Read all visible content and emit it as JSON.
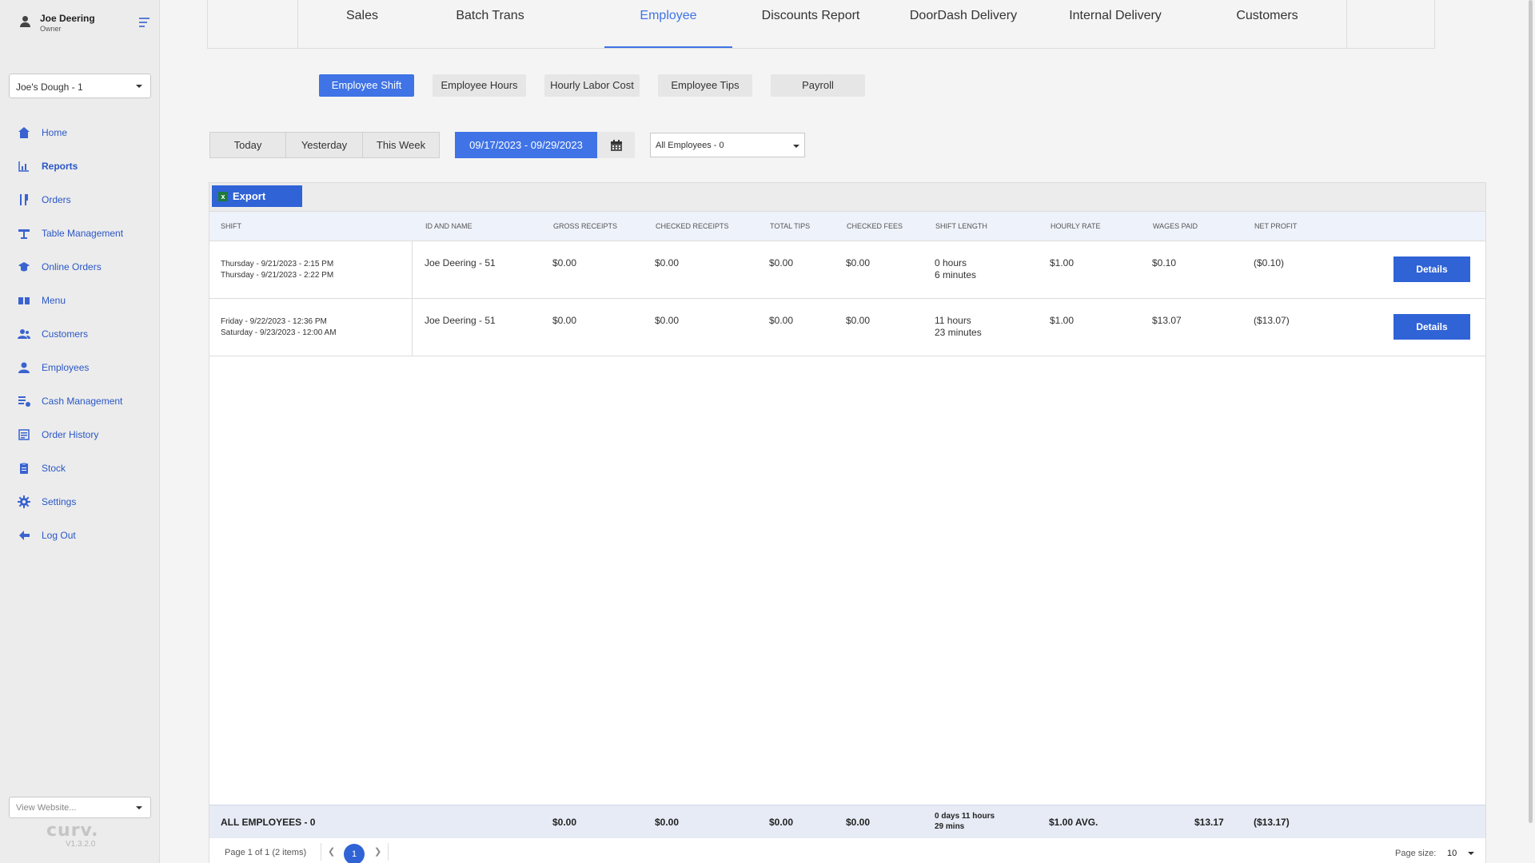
{
  "user": {
    "name": "Joe Deering",
    "role": "Owner"
  },
  "store_select": {
    "value": "Joe's Dough - 1"
  },
  "nav": [
    {
      "label": "Home",
      "icon": "home-icon",
      "active": false
    },
    {
      "label": "Reports",
      "icon": "reports-icon",
      "active": true
    },
    {
      "label": "Orders",
      "icon": "orders-icon",
      "active": false
    },
    {
      "label": "Table Management",
      "icon": "table-icon",
      "active": false
    },
    {
      "label": "Online Orders",
      "icon": "online-orders-icon",
      "active": false
    },
    {
      "label": "Menu",
      "icon": "menu-book-icon",
      "active": false
    },
    {
      "label": "Customers",
      "icon": "customers-icon",
      "active": false
    },
    {
      "label": "Employees",
      "icon": "employees-icon",
      "active": false
    },
    {
      "label": "Cash Management",
      "icon": "cash-icon",
      "active": false
    },
    {
      "label": "Order History",
      "icon": "order-history-icon",
      "active": false
    },
    {
      "label": "Stock",
      "icon": "stock-icon",
      "active": false
    },
    {
      "label": "Settings",
      "icon": "gear-icon",
      "active": false
    },
    {
      "label": "Log Out",
      "icon": "logout-arrow-icon",
      "active": false
    }
  ],
  "website_select": {
    "placeholder": "View Website..."
  },
  "brand": {
    "logo": "curv.",
    "version": "V1.3.2.0"
  },
  "report_tabs": [
    "Sales",
    "Batch Trans",
    "Employee",
    "Discounts Report",
    "DoorDash Delivery",
    "Internal Delivery",
    "Customers"
  ],
  "active_report_tab": "Employee",
  "sub_tabs": [
    "Employee Shift",
    "Employee Hours",
    "Hourly Labor Cost",
    "Employee Tips",
    "Payroll"
  ],
  "active_sub_tab": "Employee Shift",
  "range_buttons": [
    "Today",
    "Yesterday",
    "This Week"
  ],
  "date_range": "09/17/2023 - 09/29/2023",
  "employee_select": "All Employees - 0",
  "export_label": "Export",
  "columns": [
    "Shift",
    "ID and Name",
    "Gross Receipts",
    "Checked Receipts",
    "Total Tips",
    "Checked Fees",
    "Shift Length",
    "Hourly Rate",
    "Wages Paid",
    "Net Profit"
  ],
  "rows": [
    {
      "shift_start": "Thursday - 9/21/2023 - 2:15 PM",
      "shift_end": "Thursday - 9/21/2023 - 2:22 PM",
      "name": "Joe Deering - 51",
      "gross": "$0.00",
      "checked": "$0.00",
      "tips": "$0.00",
      "fees": "$0.00",
      "length_hours": "0 hours",
      "length_minutes": "6 minutes",
      "rate": "$1.00",
      "wages": "$0.10",
      "net": "($0.10)",
      "details_label": "Details"
    },
    {
      "shift_start": "Friday - 9/22/2023 - 12:36 PM",
      "shift_end": "Saturday - 9/23/2023 - 12:00 AM",
      "name": "Joe Deering - 51",
      "gross": "$0.00",
      "checked": "$0.00",
      "tips": "$0.00",
      "fees": "$0.00",
      "length_hours": "11 hours",
      "length_minutes": "23 minutes",
      "rate": "$1.00",
      "wages": "$13.07",
      "net": "($13.07)",
      "details_label": "Details"
    }
  ],
  "footer": {
    "label": "ALL EMPLOYEES - 0",
    "gross": "$0.00",
    "checked": "$0.00",
    "tips": "$0.00",
    "fees": "$0.00",
    "length_line1": "0 days 11 hours",
    "length_line2": "29 mins",
    "rate": "$1.00 AVG.",
    "wages": "$13.17",
    "net": "($13.17)"
  },
  "pager": {
    "info": "Page 1 of 1 (2 items)",
    "current_page": "1",
    "page_size_label": "Page size:",
    "page_size": "10"
  },
  "colors": {
    "accent": "#3f73e6",
    "button": "#2f63d6",
    "nav_text": "#2a56c6"
  }
}
